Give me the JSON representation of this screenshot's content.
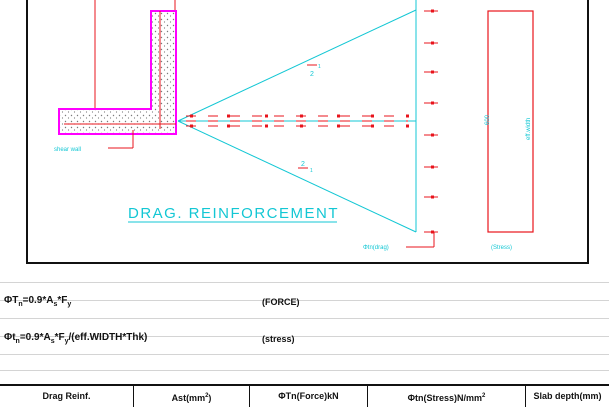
{
  "drawing": {
    "title": "DRAG. REINFORCEMENT",
    "shear_wall_label": "shear wall",
    "force_label": "Φtn(drag)",
    "stress_label": "(Stress)",
    "eff_width_label": "eff.width",
    "dim_label": "600",
    "slope_top_num": "1",
    "slope_top_den": "2",
    "slope_bot_num": "2",
    "slope_bot_den": "1",
    "colors": {
      "red": "#e8141c",
      "cyan": "#13c7d4",
      "wall_fill": "#ff00ff",
      "dots": "#7a7a7a"
    }
  },
  "formulas": {
    "force_formula": {
      "pre": "ΦT",
      "sub1": "n",
      "mid": "=0.9*A",
      "sub2": "s",
      "post": "*F",
      "sub3": "y"
    },
    "force_note": "(FORCE)",
    "stress_formula": {
      "pre": "Φt",
      "sub1": "n",
      "mid": "=0.9*A",
      "sub2": "s",
      "post": "*F",
      "sub3": "y",
      "tail": "/(eff.WIDTH*Thk)"
    },
    "stress_note": "(stress)"
  },
  "table": {
    "headers": {
      "drag_reinf": "Drag Reinf.",
      "ast": "Ast(mm",
      "ast_sup": "2",
      "ast_close": ")",
      "force": "ΦTn(Force)kN",
      "stress": "Φtn(Stress)N/mm",
      "stress_sup": "2",
      "slab": "Slab depth(mm)"
    }
  }
}
